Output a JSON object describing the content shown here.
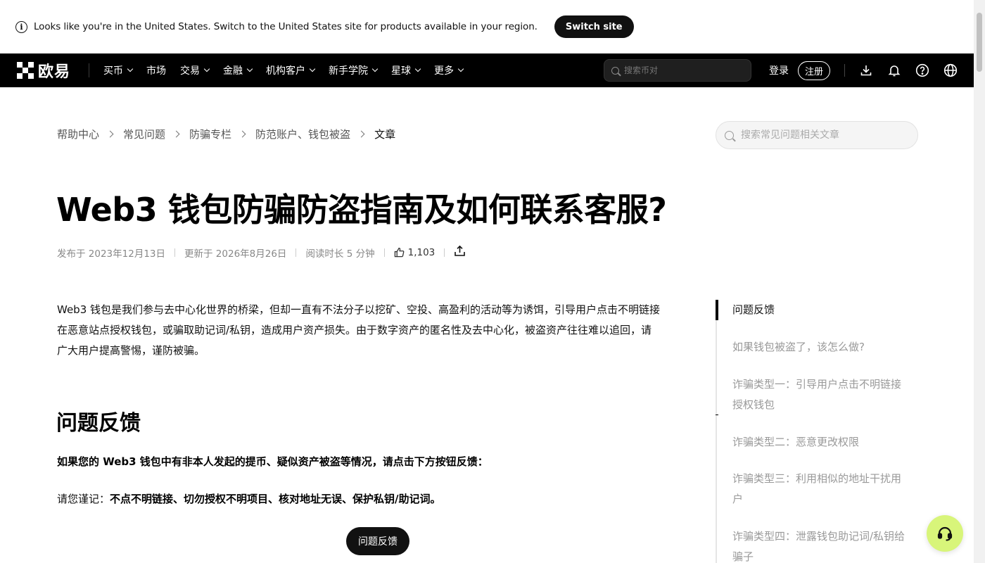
{
  "banner": {
    "message": "Looks like you're in the United States. Switch to the United States site for products available in your region.",
    "switch_label": "Switch site"
  },
  "nav": {
    "brand": "欧易",
    "items": [
      {
        "label": "买币",
        "has_dropdown": true
      },
      {
        "label": "市场",
        "has_dropdown": false
      },
      {
        "label": "交易",
        "has_dropdown": true
      },
      {
        "label": "金融",
        "has_dropdown": true
      },
      {
        "label": "机构客户",
        "has_dropdown": true
      },
      {
        "label": "新手学院",
        "has_dropdown": true
      },
      {
        "label": "星球",
        "has_dropdown": true
      },
      {
        "label": "更多",
        "has_dropdown": true
      }
    ],
    "search_placeholder": "搜索币对",
    "login_label": "登录",
    "register_label": "注册",
    "icons": [
      "download-icon",
      "bell-icon",
      "help-icon",
      "globe-icon"
    ]
  },
  "breadcrumb": [
    "帮助中心",
    "常见问题",
    "防骗专栏",
    "防范账户、钱包被盗",
    "文章"
  ],
  "help_search_placeholder": "搜索常见问题相关文章",
  "article": {
    "title": "Web3 钱包防骗防盗指南及如何联系客服?",
    "published": "发布于 2023年12月13日",
    "updated": "更新于 2026年8月26日",
    "read_time": "阅读时长 5 分钟",
    "likes": "1,103",
    "intro_lines": [
      "Web3 钱包是我们参与去中心化世界的桥梁，但却一直有不法分子以挖矿、空投、高盈利的活动等为诱饵，引导用户点击不明链接",
      "在恶意站点授权钱包，或骗取助记词/私钥，造成用户资产损失。由于数字资产的匿名性及去中心化，被盗资产往往难以追回，请",
      "广大用户提高警惕，谨防被骗。"
    ],
    "section_heading": "问题反馈",
    "bold_line": "如果您的 Web3 钱包中有非本人发起的提币、疑似资产被盗等情况，请点击下方按钮反馈：",
    "remember_prefix": "请您谨记：",
    "remember_bold": "不点不明链接、切勿授权不明项目、核对地址无误、保护私钥/助记词。",
    "feedback_button": "问题反馈"
  },
  "toc": [
    {
      "lines": [
        "问题反馈"
      ],
      "active": true
    },
    {
      "lines": [
        "如果钱包被盗了，该怎么做?"
      ],
      "active": false
    },
    {
      "lines": [
        "诈骗类型一：引导用户点击不明链接",
        "授权钱包"
      ],
      "active": false
    },
    {
      "lines": [
        "诈骗类型二：恶意更改权限"
      ],
      "active": false
    },
    {
      "lines": [
        "诈骗类型三：利用相似的地址干扰用",
        "户"
      ],
      "active": false
    },
    {
      "lines": [
        "诈骗类型四：泄露钱包助记词/私钥给",
        "骗子"
      ],
      "active": false
    }
  ],
  "colors": {
    "nav_bg": "#000000",
    "accent_support": "#d8f57a",
    "button_dark": "#111111"
  }
}
